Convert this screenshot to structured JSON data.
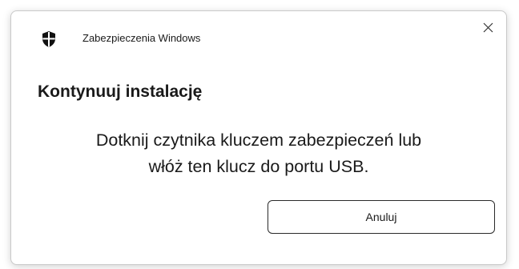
{
  "window": {
    "app_title": "Zabezpieczenia Windows",
    "app_icon": "shield-icon",
    "close_icon": "close-icon"
  },
  "dialog": {
    "heading": "Kontynuuj instalację",
    "message_line1": "Dotknij czytnika kluczem zabezpieczeń lub",
    "message_line2": "włóż ten klucz do portu USB.",
    "cancel_label": "Anuluj"
  },
  "colors": {
    "text": "#1a1a1a",
    "border": "#c9c9c9",
    "button_border": "#2a2a2a"
  }
}
